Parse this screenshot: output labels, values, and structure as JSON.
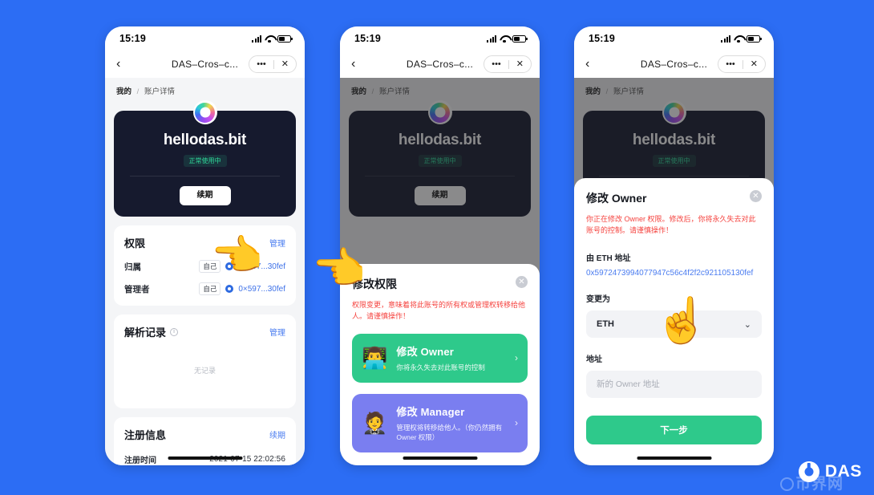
{
  "background_color": "#2c6df4",
  "status_bar": {
    "time": "15:19"
  },
  "nav": {
    "back_icon": "chevron-left-icon",
    "title": "DAS–Cros–c...",
    "more_label": "•••",
    "close_label": "✕"
  },
  "breadcrumb": {
    "root": "我的",
    "separator": "/",
    "current": "账户详情"
  },
  "account_card": {
    "logo_icon": "das-logo-icon",
    "name": "hellodas.bit",
    "status_badge": "正常使用中",
    "renew_button": "续期"
  },
  "permission_panel": {
    "title": "权限",
    "action": "管理",
    "rows": [
      {
        "label": "归属",
        "tag": "自己",
        "chain_icon": "ethereum-dot-icon",
        "address": "0×597...30fef"
      },
      {
        "label": "管理者",
        "tag": "自己",
        "chain_icon": "ethereum-dot-icon",
        "address": "0×597...30fef"
      }
    ]
  },
  "records_panel": {
    "title": "解析记录",
    "info_icon": "info-circle-icon",
    "action": "管理",
    "empty_text": "无记录"
  },
  "registration_panel": {
    "title": "注册信息",
    "action": "续期",
    "rows": [
      {
        "label": "注册时间",
        "value": "2021-07-15 22:02:56"
      }
    ]
  },
  "permission_sheet": {
    "title": "修改权限",
    "close_icon": "close-circle-icon",
    "warning": "权限变更，意味着将此账号的所有权或管理权转移给他人。请谨慎操作！",
    "options": [
      {
        "emoji": "👨‍💻",
        "emoji_name": "technologist-emoji",
        "title": "修改 Owner",
        "subtitle": "你将永久失去对此账号的控制",
        "chevron": "›",
        "color": "#2ec98b"
      },
      {
        "emoji": "🤵",
        "emoji_name": "person-in-suit-emoji",
        "title": "修改 Manager",
        "subtitle": "管理权将转移给他人。（你仍然拥有 Owner 权限）",
        "chevron": "›",
        "color": "#7a7ef0"
      }
    ]
  },
  "owner_sheet": {
    "title": "修改 Owner",
    "close_icon": "close-circle-icon",
    "warning": "你正在修改 Owner 权限。修改后，你将永久失去对此账号的控制。请谨慎操作！",
    "from_label": "由 ETH 地址",
    "from_address": "0x5972473994077947c56c4f2f2c921105130fef",
    "change_to_label": "变更为",
    "chain_selected": "ETH",
    "chevron_icon": "chevron-down-icon",
    "address_label": "地址",
    "address_placeholder": "新的 Owner 地址",
    "address_value": "",
    "submit_button": "下一步"
  },
  "pointers": [
    {
      "emoji": "👈",
      "name": "pointing-hand-permission-manage"
    },
    {
      "emoji": "👈",
      "name": "pointing-hand-modify-owner"
    },
    {
      "emoji": "☝️",
      "name": "pointing-hand-chain-select"
    }
  ],
  "watermark": {
    "brand": "DAS",
    "logo_icon": "das-brand-icon",
    "stamp": "币界网"
  }
}
